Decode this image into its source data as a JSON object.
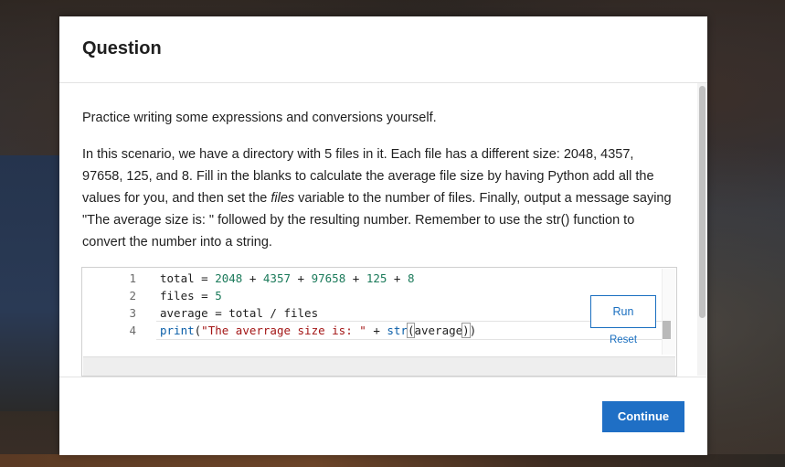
{
  "modal": {
    "title": "Question",
    "body": {
      "intro": "Practice writing some expressions and conversions yourself.",
      "scenario_part1": "In this scenario, we have a directory with 5 files in it. Each file has a different size: 2048, 4357, 97658, 125, and 8. Fill in the blanks to calculate the average file size by having Python add all the values for you, and then set the ",
      "scenario_italic": "files",
      "scenario_part2": " variable to the number of files. Finally, output a message saying \"The average size is: \" followed by the resulting number. Remember to use the str() function to convert the number into a string."
    },
    "code_editor": {
      "lines": [
        {
          "number": "1",
          "tokens": [
            {
              "t": "total = ",
              "c": ""
            },
            {
              "t": "2048",
              "c": "num"
            },
            {
              "t": " + ",
              "c": ""
            },
            {
              "t": "4357",
              "c": "num"
            },
            {
              "t": " + ",
              "c": ""
            },
            {
              "t": "97658",
              "c": "num"
            },
            {
              "t": " + ",
              "c": ""
            },
            {
              "t": "125",
              "c": "num"
            },
            {
              "t": " + ",
              "c": ""
            },
            {
              "t": "8",
              "c": "num"
            }
          ]
        },
        {
          "number": "2",
          "tokens": [
            {
              "t": "files = ",
              "c": ""
            },
            {
              "t": "5",
              "c": "num"
            }
          ]
        },
        {
          "number": "3",
          "tokens": [
            {
              "t": "average = total / files",
              "c": ""
            }
          ]
        },
        {
          "number": "4",
          "tokens": [
            {
              "t": "print",
              "c": "fn"
            },
            {
              "t": "(",
              "c": ""
            },
            {
              "t": "\"The averrage size is: \"",
              "c": "str"
            },
            {
              "t": " + ",
              "c": ""
            },
            {
              "t": "str",
              "c": "fn"
            },
            {
              "t": "(",
              "c": "paren-box"
            },
            {
              "t": "average",
              "c": ""
            },
            {
              "t": ")",
              "c": "paren-box"
            },
            {
              "t": ")",
              "c": ""
            }
          ]
        }
      ],
      "run_label": "Run",
      "reset_label": "Reset"
    },
    "footer": {
      "continue_label": "Continue"
    }
  },
  "colors": {
    "accent": "#1f6fc5",
    "number_token": "#1b7a5a",
    "string_token": "#a31515",
    "function_token": "#0a5ea8"
  }
}
